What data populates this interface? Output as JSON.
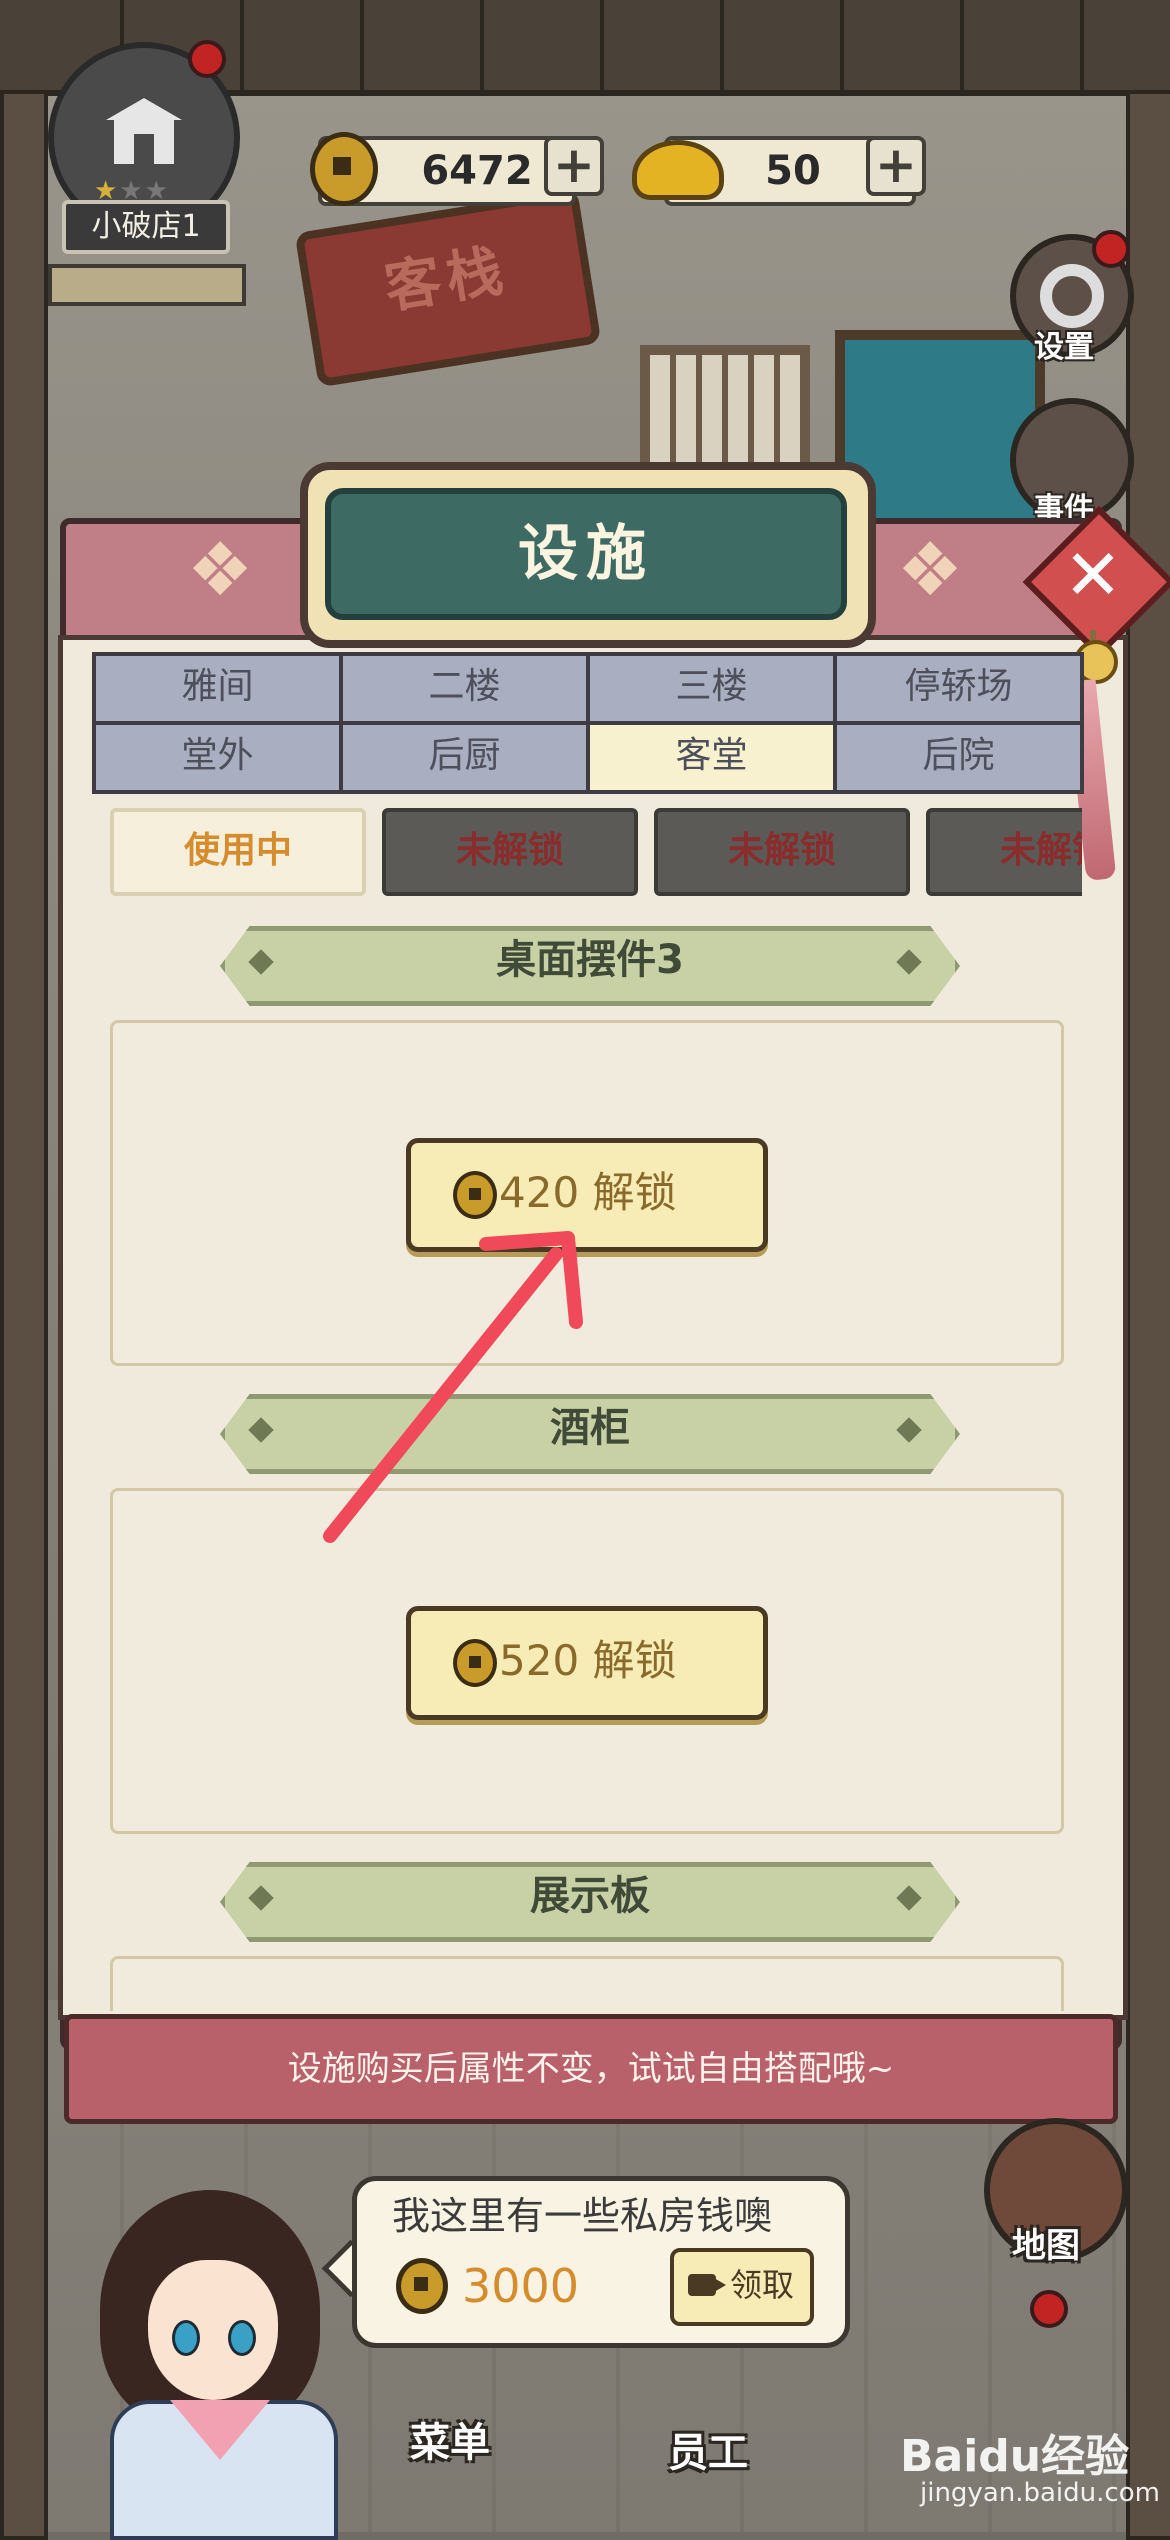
{
  "hud": {
    "shop_name": "小破店1",
    "shop_stars": 1,
    "shop_stars_max": 3,
    "coins": "6472",
    "ingots": "50",
    "plus_label": "+"
  },
  "side_buttons": {
    "settings_label": "设置",
    "events_label": "事件",
    "map_label": "地图"
  },
  "background": {
    "sign_text": "客栈"
  },
  "panel": {
    "title": "设施",
    "close_label": "✕",
    "tabs_row1": [
      "雅间",
      "二楼",
      "三楼",
      "停轿场"
    ],
    "tabs_row2": [
      "堂外",
      "后厨",
      "客堂",
      "后院"
    ],
    "active_tab": "客堂",
    "subtabs": [
      "使用中",
      "未解锁",
      "未解锁",
      "未解锁"
    ],
    "sections": [
      {
        "title": "桌面摆件3",
        "unlock_price": "420",
        "unlock_label": "解锁"
      },
      {
        "title": "酒柜",
        "unlock_price": "520",
        "unlock_label": "解锁"
      },
      {
        "title": "展示板"
      }
    ],
    "tip": "设施购买后属性不变，试试自由搭配哦~"
  },
  "bubble": {
    "text": "我这里有一些私房钱噢",
    "amount": "3000",
    "claim_label": "领取"
  },
  "dock": {
    "menu_label": "菜单",
    "staff_label": "员工"
  },
  "watermark": {
    "brand": "Baidu经验",
    "url": "jingyan.baidu.com"
  },
  "colors": {
    "panel_pink": "#c07f86",
    "panel_cream": "#efeadb",
    "title_teal": "#3d6a63",
    "tab_inactive": "#a9aec0",
    "tab_active": "#f7f1cf",
    "coin_gold": "#c89b2a",
    "arrow_red": "#f04a5a"
  }
}
